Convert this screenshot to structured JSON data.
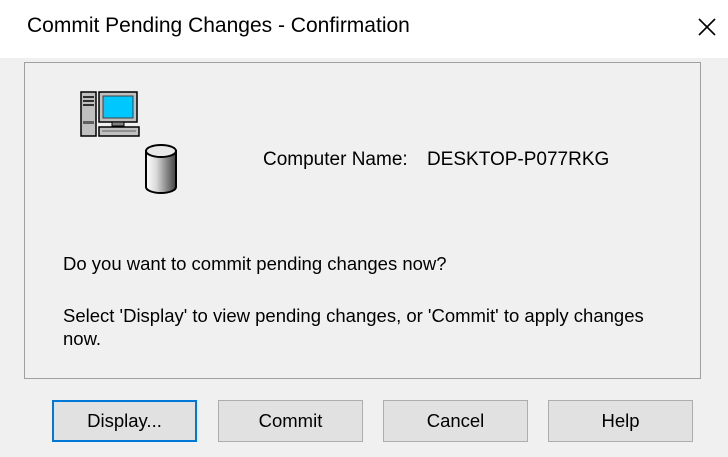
{
  "window": {
    "title": "Commit Pending Changes - Confirmation",
    "close_icon": "close-icon"
  },
  "computer": {
    "label": "Computer Name:",
    "value": "DESKTOP-P077RKG"
  },
  "message": {
    "question": "Do you want to commit pending changes now?",
    "hint": "Select 'Display' to view pending changes, or 'Commit' to apply changes now."
  },
  "buttons": {
    "display": "Display...",
    "commit": "Commit",
    "cancel": "Cancel",
    "help": "Help"
  },
  "icons": {
    "computer": "computer-icon",
    "database": "database-icon"
  },
  "colors": {
    "dialog_bg": "#f0f0f0",
    "button_bg": "#e1e1e1",
    "focus_border": "#0078d7",
    "screen": "#00c8ff"
  }
}
